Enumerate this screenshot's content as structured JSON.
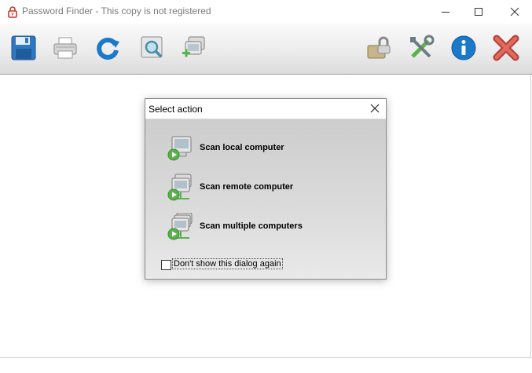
{
  "window": {
    "title": "Password Finder - This copy is not registered"
  },
  "toolbar": {
    "left_buttons": [
      {
        "icon": "save-icon"
      },
      {
        "icon": "print-icon"
      },
      {
        "icon": "refresh-icon"
      },
      {
        "icon": "find-icon"
      },
      {
        "icon": "add-computer-icon"
      }
    ],
    "right_buttons": [
      {
        "icon": "register-icon"
      },
      {
        "icon": "settings-tools-icon"
      },
      {
        "icon": "info-icon"
      },
      {
        "icon": "exit-icon"
      }
    ]
  },
  "dialog": {
    "title": "Select action",
    "actions": [
      {
        "label": "Scan local computer",
        "icon": "local-computer-scan-icon"
      },
      {
        "label": "Scan remote computer",
        "icon": "remote-computer-scan-icon"
      },
      {
        "label": "Scan multiple computers",
        "icon": "multiple-computers-scan-icon"
      }
    ],
    "dont_show_label": "Don't show this dialog again",
    "dont_show_checked": false
  },
  "colors": {
    "accent_blue": "#1a79c9",
    "exit_red": "#d9534f",
    "play_green": "#59b34a"
  }
}
